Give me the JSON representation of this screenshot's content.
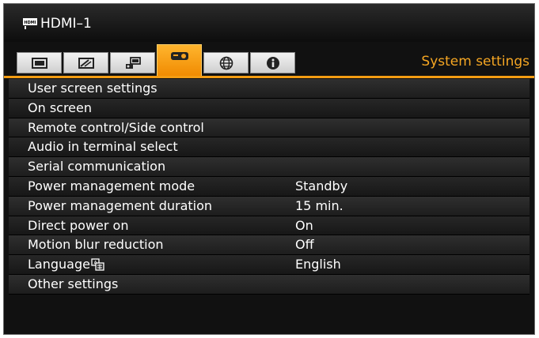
{
  "source": {
    "label": "HDMI–1",
    "icon": "hdmi-icon"
  },
  "tabs": {
    "items": [
      {
        "icon": "image-adjust-icon"
      },
      {
        "icon": "screen-settings-icon"
      },
      {
        "icon": "install-settings-icon"
      },
      {
        "icon": "projector-icon",
        "active": true
      },
      {
        "icon": "network-globe-icon"
      },
      {
        "icon": "info-icon"
      }
    ],
    "active_title": "System settings"
  },
  "menu": {
    "items": [
      {
        "label": "User screen settings",
        "value": ""
      },
      {
        "label": "On screen",
        "value": ""
      },
      {
        "label": "Remote control/Side control",
        "value": ""
      },
      {
        "label": "Audio in terminal select",
        "value": ""
      },
      {
        "label": "Serial communication",
        "value": ""
      },
      {
        "label": "Power management mode",
        "value": "Standby"
      },
      {
        "label": "Power management duration",
        "value": "15 min."
      },
      {
        "label": "Direct power on",
        "value": "On"
      },
      {
        "label": "Motion blur reduction",
        "value": "Off"
      },
      {
        "label": "Language",
        "value": "English",
        "icon": "language-icon"
      },
      {
        "label": "Other settings",
        "value": ""
      }
    ]
  },
  "colors": {
    "accent": "#f39c12",
    "title": "#f5a623",
    "background": "#111111",
    "text": "#ffffff"
  }
}
